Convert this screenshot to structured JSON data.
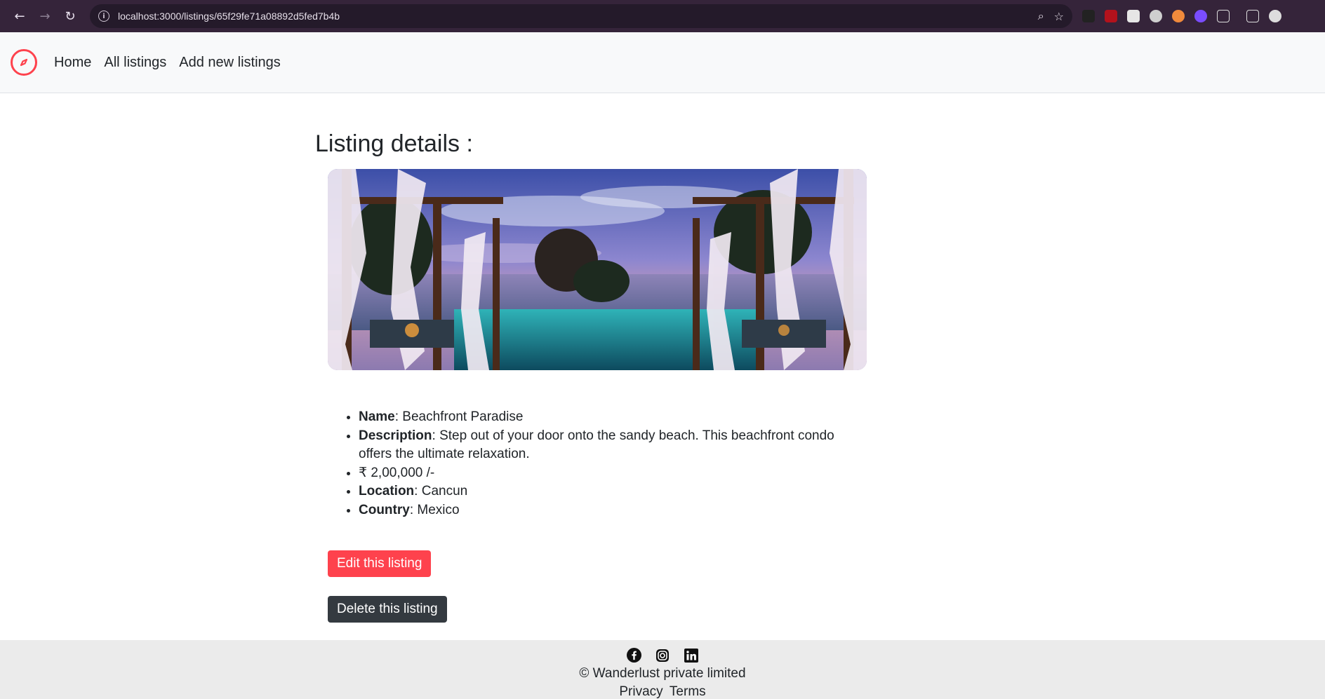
{
  "browser": {
    "url": "localhost:3000/listings/65f29fe71a08892d5fed7b4b"
  },
  "navbar": {
    "links": [
      "Home",
      "All listings",
      "Add new listings"
    ]
  },
  "listing": {
    "heading": "Listing details :",
    "name_label": "Name",
    "name": ": Beachfront Paradise",
    "description_label": "Description",
    "description": ": Step out of your door onto the sandy beach. This beachfront condo offers the ultimate relaxation.",
    "price": "₹ 2,00,000 /-",
    "location_label": "Location",
    "location": ": Cancun",
    "country_label": "Country",
    "country": ": Mexico"
  },
  "actions": {
    "edit": "Edit this listing",
    "delete": "Delete this listing"
  },
  "footer": {
    "copyright": "© Wanderlust private limited",
    "privacy": "Privacy",
    "terms": "Terms"
  },
  "colors": {
    "brand": "#fe424d",
    "dark_button": "#343a40",
    "footer_bg": "#ebebeb"
  }
}
